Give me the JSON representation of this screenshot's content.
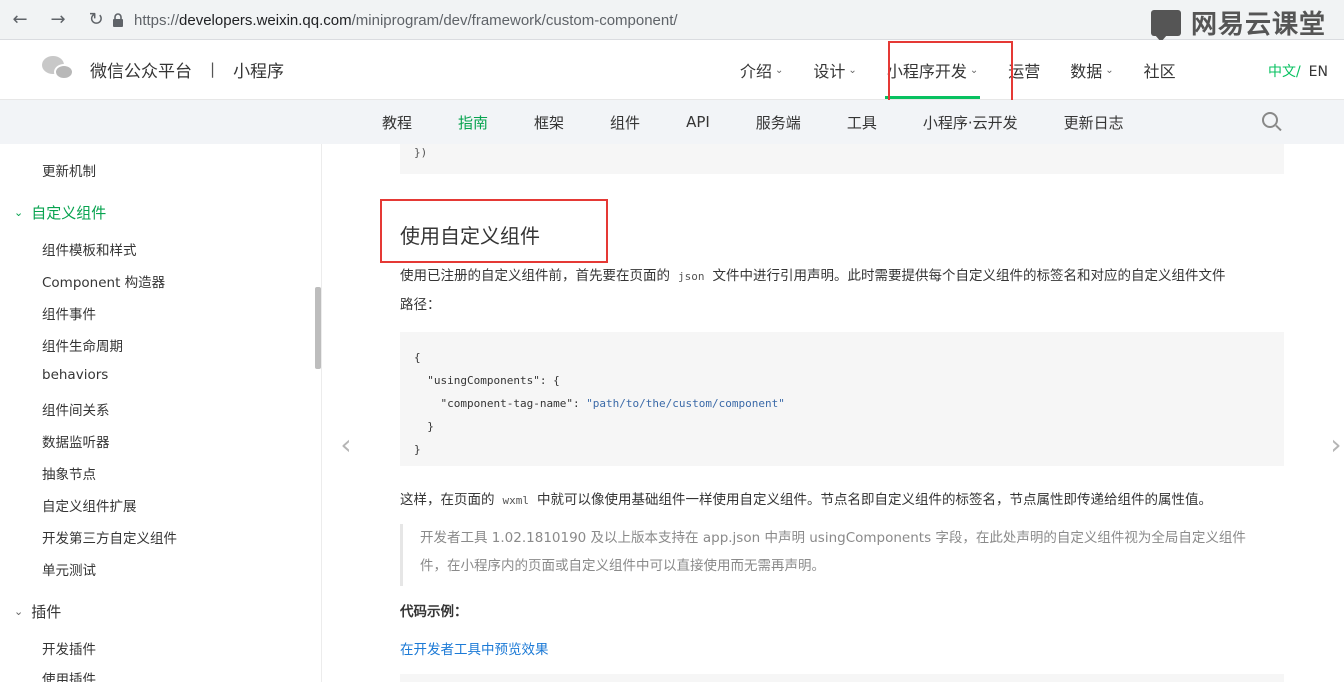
{
  "browser": {
    "url_scheme": "https://",
    "url_host": "developers.weixin.qq.com",
    "url_path": "/miniprogram/dev/framework/custom-component/",
    "watermark": "网易云课堂"
  },
  "header": {
    "brand_name": "微信公众平台",
    "brand_sep": "|",
    "brand_sub": "小程序",
    "nav": [
      {
        "label": "介绍",
        "chev": "⌄"
      },
      {
        "label": "设计",
        "chev": "⌄"
      },
      {
        "label": "小程序开发",
        "chev": "⌄"
      },
      {
        "label": "运营",
        "chev": ""
      },
      {
        "label": "数据",
        "chev": "⌄"
      },
      {
        "label": "社区",
        "chev": ""
      }
    ],
    "lang_zh": "中文/",
    "lang_en": "EN"
  },
  "subnav": {
    "items": [
      "教程",
      "指南",
      "框架",
      "组件",
      "API",
      "服务端",
      "工具",
      "小程序·云开发",
      "更新日志"
    ]
  },
  "sidebar": {
    "item_update": "更新机制",
    "section_custom": "自定义组件",
    "items": [
      "组件模板和样式",
      "Component 构造器",
      "组件事件",
      "组件生命周期",
      "behaviors",
      "组件间关系",
      "数据监听器",
      "抽象节点",
      "自定义组件扩展",
      "开发第三方自定义组件",
      "单元测试"
    ],
    "section_plugin": "插件",
    "plugin_items": [
      "开发插件",
      "使用插件"
    ],
    "chev_open": "⌄",
    "chev_closed": "⌄"
  },
  "content": {
    "code_top": "})",
    "heading": "使用自定义组件",
    "para1_a": "使用已注册的自定义组件前，首先要在页面的",
    "para1_code": "json",
    "para1_b": "文件中进行引用声明。此时需要提供每个自定义组件的标签名和对应的自定义组件文件",
    "para1_c": "路径：",
    "code_l1": "{",
    "code_l2_key": "  \"usingComponents\": {",
    "code_l3_key": "    \"component-tag-name\": ",
    "code_l3_val": "\"path/to/the/custom/component\"",
    "code_l4": "  }",
    "code_l5": "}",
    "para2_a": "这样，在页面的",
    "para2_code": "wxml",
    "para2_b": "中就可以像使用基础组件一样使用自定义组件。节点名即自定义组件的标签名，节点属性即传递给组件的属性值。",
    "quote_l1": "开发者工具 1.02.1810190 及以上版本支持在 app.json 中声明 usingComponents 字段，在此处声明的自定义组件视为全局自定义组件",
    "quote_l2": "件，在小程序内的页面或自定义组件中可以直接使用而无需再声明。",
    "example_label": "代码示例：",
    "preview_link": "在开发者工具中预览效果"
  },
  "pager": {
    "prev": "‹",
    "next": "›"
  }
}
